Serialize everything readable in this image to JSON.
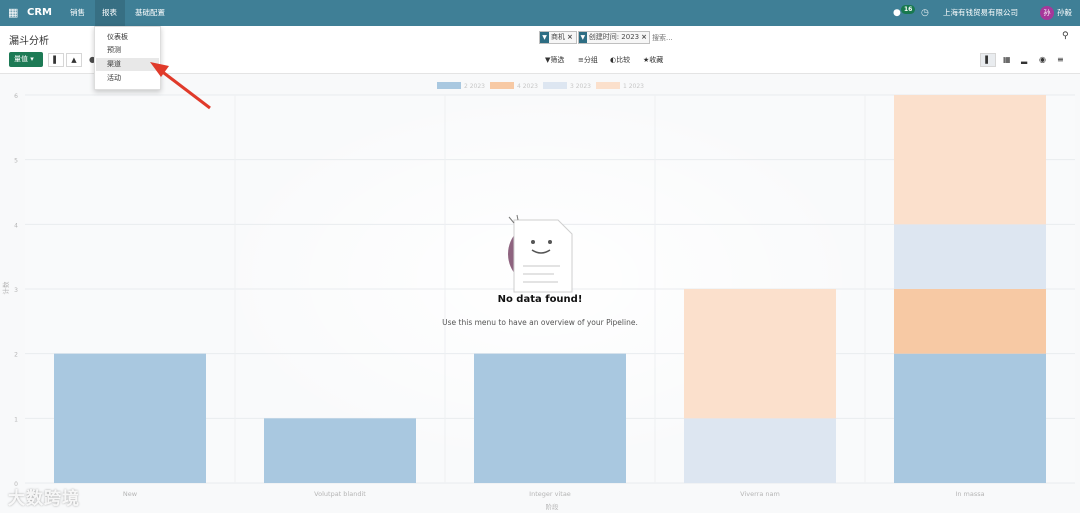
{
  "navbar": {
    "app_name": "CRM",
    "menus": [
      "销售",
      "报表",
      "基础配置"
    ],
    "notification_count": "16",
    "company": "上海有钱贸易有限公司",
    "user_initial": "孙",
    "user_name": "孙毅"
  },
  "reports_menu": {
    "items": [
      "仪表板",
      "预测",
      "渠道",
      "活动"
    ],
    "active": "渠道"
  },
  "control_panel": {
    "title": "漏斗分析",
    "measures_label": "量值",
    "filters": [
      {
        "label": "商机"
      },
      {
        "label": "创建时间: 2023"
      }
    ],
    "search_placeholder": "搜索...",
    "filter_label": "筛选",
    "groupby_label": "分组",
    "compare_label": "比较",
    "favorites_label": "收藏"
  },
  "no_data": {
    "title": "No data found!",
    "help": "Use this menu to have an overview of your Pipeline."
  },
  "chart_data": {
    "type": "bar",
    "stacked": true,
    "categories": [
      "New",
      "Volutpat blandit",
      "Integer vitae",
      "Viverra nam",
      "In massa"
    ],
    "series": [
      {
        "name": "2 2023",
        "color": "#a9c8e0",
        "values": [
          2,
          1,
          2,
          0,
          2
        ]
      },
      {
        "name": "4 2023",
        "color": "#f7c9a4",
        "values": [
          0,
          0,
          0,
          0,
          1
        ]
      },
      {
        "name": "3 2023",
        "color": "#dde6f1",
        "values": [
          0,
          0,
          0,
          1,
          1
        ]
      },
      {
        "name": "1 2023",
        "color": "#fbe0cc",
        "values": [
          0,
          0,
          0,
          2,
          2
        ]
      }
    ],
    "ylim": [
      0,
      6
    ],
    "yticks": [
      "0",
      "1",
      "2",
      "3",
      "4",
      "5",
      "6"
    ],
    "xlabel": "阶段",
    "ylabel": "计数",
    "legend_position": "top"
  },
  "watermark": "大数跨境"
}
